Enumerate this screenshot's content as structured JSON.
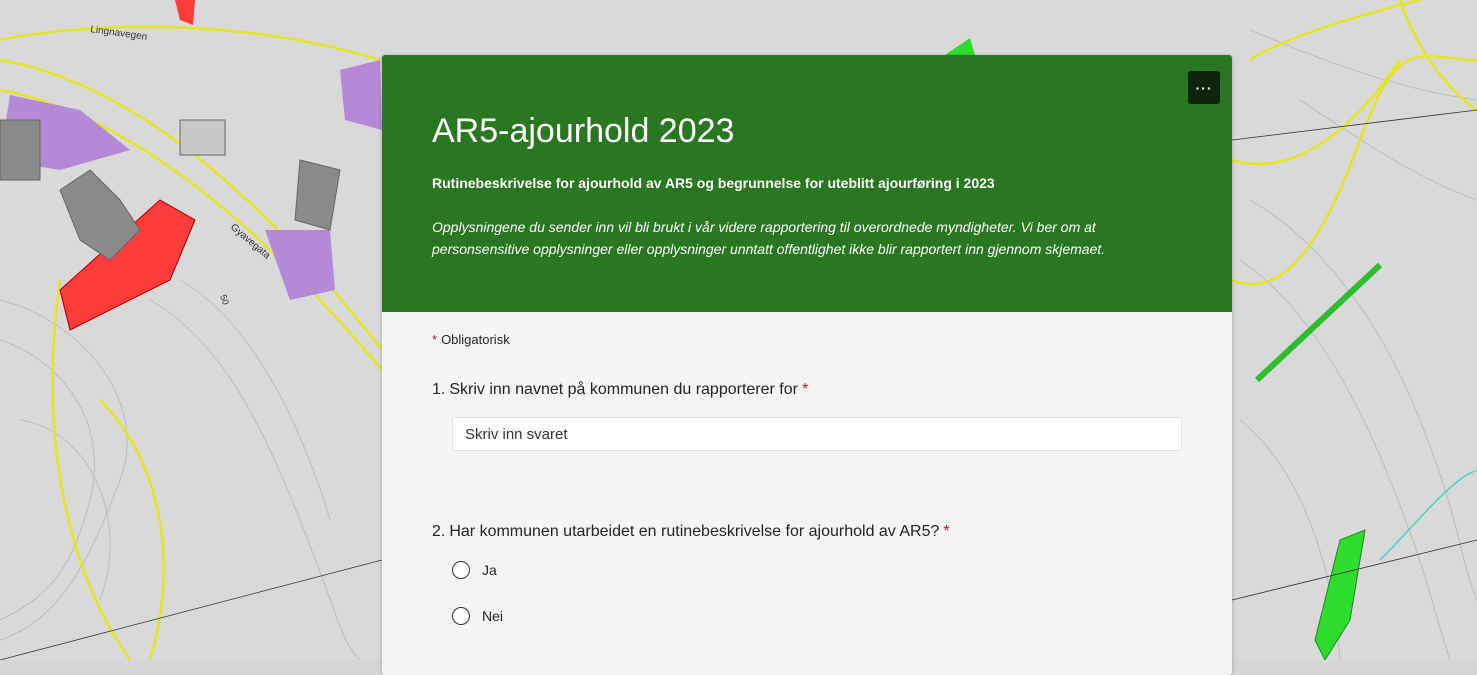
{
  "form": {
    "title": "AR5-ajourhold 2023",
    "subtitle": "Rutinebeskrivelse for ajourhold av AR5 og begrunnelse for uteblitt ajourføring i 2023",
    "description": "Opplysningene du sender inn vil bli brukt i vår videre rapportering til overordnede myndigheter. Vi ber om at personsensitive opplysninger eller opplysninger unntatt offentlighet ikke blir rapportert inn gjennom skjemaet.",
    "more_label": "···",
    "required_star": "*",
    "required_note": "Obligatorisk",
    "header_color": "#2a7722"
  },
  "questions": [
    {
      "number": "1.",
      "text": "Skriv inn navnet på kommunen du rapporterer for",
      "star": "*",
      "placeholder": "Skriv inn svaret"
    },
    {
      "number": "2.",
      "text": "Har kommunen utarbeidet en rutinebeskrivelse for ajourhold av AR5?",
      "star": "*",
      "options": [
        "Ja",
        "Nei"
      ]
    }
  ],
  "map": {
    "road_labels": [
      "Lingnavegen",
      "Gyavegata",
      "50"
    ]
  }
}
